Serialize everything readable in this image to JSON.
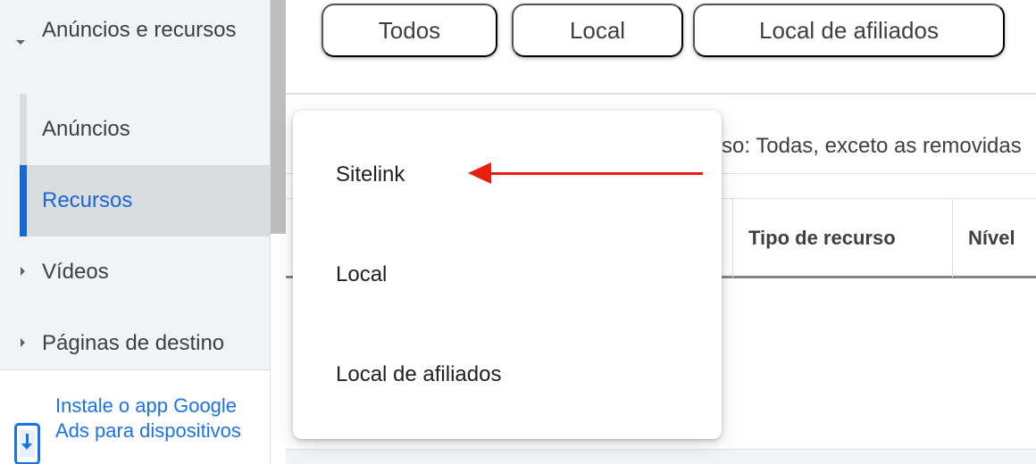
{
  "sidebar": {
    "group": {
      "label": "Anúncios e recursos"
    },
    "sub_items": [
      {
        "label": "Anúncios"
      },
      {
        "label": "Recursos"
      }
    ],
    "items": [
      {
        "label": "Vídeos"
      },
      {
        "label": "Páginas de destino"
      }
    ],
    "install_app": {
      "text": "Instale o app Google Ads para dispositivos"
    }
  },
  "chips": [
    {
      "label": "Todos"
    },
    {
      "label": "Local"
    },
    {
      "label": "Local de afiliados"
    }
  ],
  "filter": {
    "text": "so: Todas, exceto as removidas"
  },
  "table": {
    "headers": [
      "Tipo de recurso",
      "Nível"
    ]
  },
  "menu": {
    "items": [
      {
        "label": "Sitelink"
      },
      {
        "label": "Local"
      },
      {
        "label": "Local de afiliados"
      }
    ]
  },
  "colors": {
    "accent": "#1967d2",
    "annotation_arrow": "#ea1f12"
  },
  "icons": {
    "expand": "caret-down-icon",
    "collapsed": "caret-right-icon",
    "install": "mobile-download-icon",
    "annotation": "red-arrow-icon"
  }
}
